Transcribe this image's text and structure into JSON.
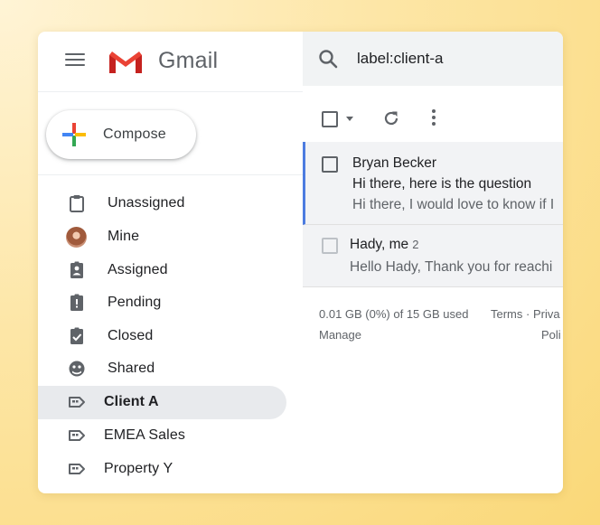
{
  "header": {
    "brand": "Gmail",
    "search_query": "label:client-a"
  },
  "compose": {
    "label": "Compose"
  },
  "sidebar": {
    "items": [
      {
        "label": "Unassigned",
        "icon": "clipboard-icon"
      },
      {
        "label": "Mine",
        "icon": "avatar"
      },
      {
        "label": "Assigned",
        "icon": "assigned-badge-icon"
      },
      {
        "label": "Pending",
        "icon": "pending-clipboard-icon"
      },
      {
        "label": "Closed",
        "icon": "check-clipboard-icon"
      },
      {
        "label": "Shared",
        "icon": "shared-face-icon"
      },
      {
        "label": "Client A",
        "icon": "label-icon",
        "active": true
      },
      {
        "label": "EMEA Sales",
        "icon": "label-icon"
      },
      {
        "label": "Property Y",
        "icon": "label-icon"
      }
    ]
  },
  "emails": [
    {
      "sender": "Bryan Becker",
      "subject": "Hi there, here is the question",
      "snippet": "Hi there, I would love to know if I"
    },
    {
      "sender": "Hady, me",
      "count": "2",
      "snippet": "Hello Hady, Thank you for reachi"
    }
  ],
  "footer": {
    "storage": "0.01 GB (0%) of 15 GB used",
    "manage": "Manage",
    "terms": "Terms · Priva",
    "policy": "Poli"
  },
  "colors": {
    "accent_blue": "#4d7ce0",
    "active_bg": "#e8eaed",
    "gmail_red": "#ea4335"
  }
}
